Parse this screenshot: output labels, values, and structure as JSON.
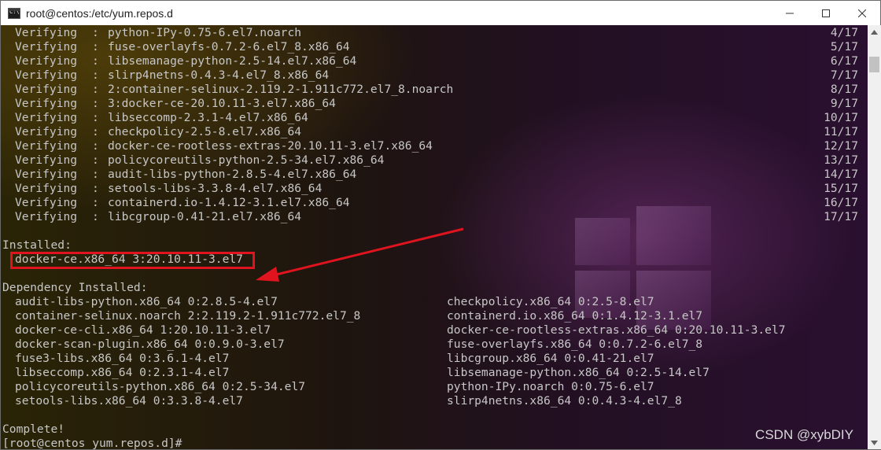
{
  "window": {
    "title": "root@centos:/etc/yum.repos.d",
    "buttons": [
      "minimize",
      "maximize",
      "close"
    ]
  },
  "verifying": [
    {
      "label": "Verifying",
      "pkg": "python-IPy-0.75-6.el7.noarch",
      "count": "4/17"
    },
    {
      "label": "Verifying",
      "pkg": "fuse-overlayfs-0.7.2-6.el7_8.x86_64",
      "count": "5/17"
    },
    {
      "label": "Verifying",
      "pkg": "libsemanage-python-2.5-14.el7.x86_64",
      "count": "6/17"
    },
    {
      "label": "Verifying",
      "pkg": "slirp4netns-0.4.3-4.el7_8.x86_64",
      "count": "7/17"
    },
    {
      "label": "Verifying",
      "pkg": "2:container-selinux-2.119.2-1.911c772.el7_8.noarch",
      "count": "8/17"
    },
    {
      "label": "Verifying",
      "pkg": "3:docker-ce-20.10.11-3.el7.x86_64",
      "count": "9/17"
    },
    {
      "label": "Verifying",
      "pkg": "libseccomp-2.3.1-4.el7.x86_64",
      "count": "10/17"
    },
    {
      "label": "Verifying",
      "pkg": "checkpolicy-2.5-8.el7.x86_64",
      "count": "11/17"
    },
    {
      "label": "Verifying",
      "pkg": "docker-ce-rootless-extras-20.10.11-3.el7.x86_64",
      "count": "12/17"
    },
    {
      "label": "Verifying",
      "pkg": "policycoreutils-python-2.5-34.el7.x86_64",
      "count": "13/17"
    },
    {
      "label": "Verifying",
      "pkg": "audit-libs-python-2.8.5-4.el7.x86_64",
      "count": "14/17"
    },
    {
      "label": "Verifying",
      "pkg": "setools-libs-3.3.8-4.el7.x86_64",
      "count": "15/17"
    },
    {
      "label": "Verifying",
      "pkg": "containerd.io-1.4.12-3.1.el7.x86_64",
      "count": "16/17"
    },
    {
      "label": "Verifying",
      "pkg": "libcgroup-0.41-21.el7.x86_64",
      "count": "17/17"
    }
  ],
  "installed": {
    "heading": "Installed:",
    "pkg": "docker-ce.x86_64 3:20.10.11-3.el7"
  },
  "dependency": {
    "heading": "Dependency Installed:",
    "left": [
      "audit-libs-python.x86_64 0:2.8.5-4.el7",
      "container-selinux.noarch 2:2.119.2-1.911c772.el7_8",
      "docker-ce-cli.x86_64 1:20.10.11-3.el7",
      "docker-scan-plugin.x86_64 0:0.9.0-3.el7",
      "fuse3-libs.x86_64 0:3.6.1-4.el7",
      "libseccomp.x86_64 0:2.3.1-4.el7",
      "policycoreutils-python.x86_64 0:2.5-34.el7",
      "setools-libs.x86_64 0:3.3.8-4.el7"
    ],
    "right": [
      "checkpolicy.x86_64 0:2.5-8.el7",
      "containerd.io.x86_64 0:1.4.12-3.1.el7",
      "docker-ce-rootless-extras.x86_64 0:20.10.11-3.el7",
      "fuse-overlayfs.x86_64 0:0.7.2-6.el7_8",
      "libcgroup.x86_64 0:0.41-21.el7",
      "libsemanage-python.x86_64 0:2.5-14.el7",
      "python-IPy.noarch 0:0.75-6.el7",
      "slirp4netns.x86_64 0:0.4.3-4.el7_8"
    ]
  },
  "complete": "Complete!",
  "prompt": "[root@centos yum.repos.d]#",
  "watermark": "CSDN @xybDIY",
  "colors": {
    "highlight": "#e0141e",
    "text": "#c7c7c7"
  }
}
